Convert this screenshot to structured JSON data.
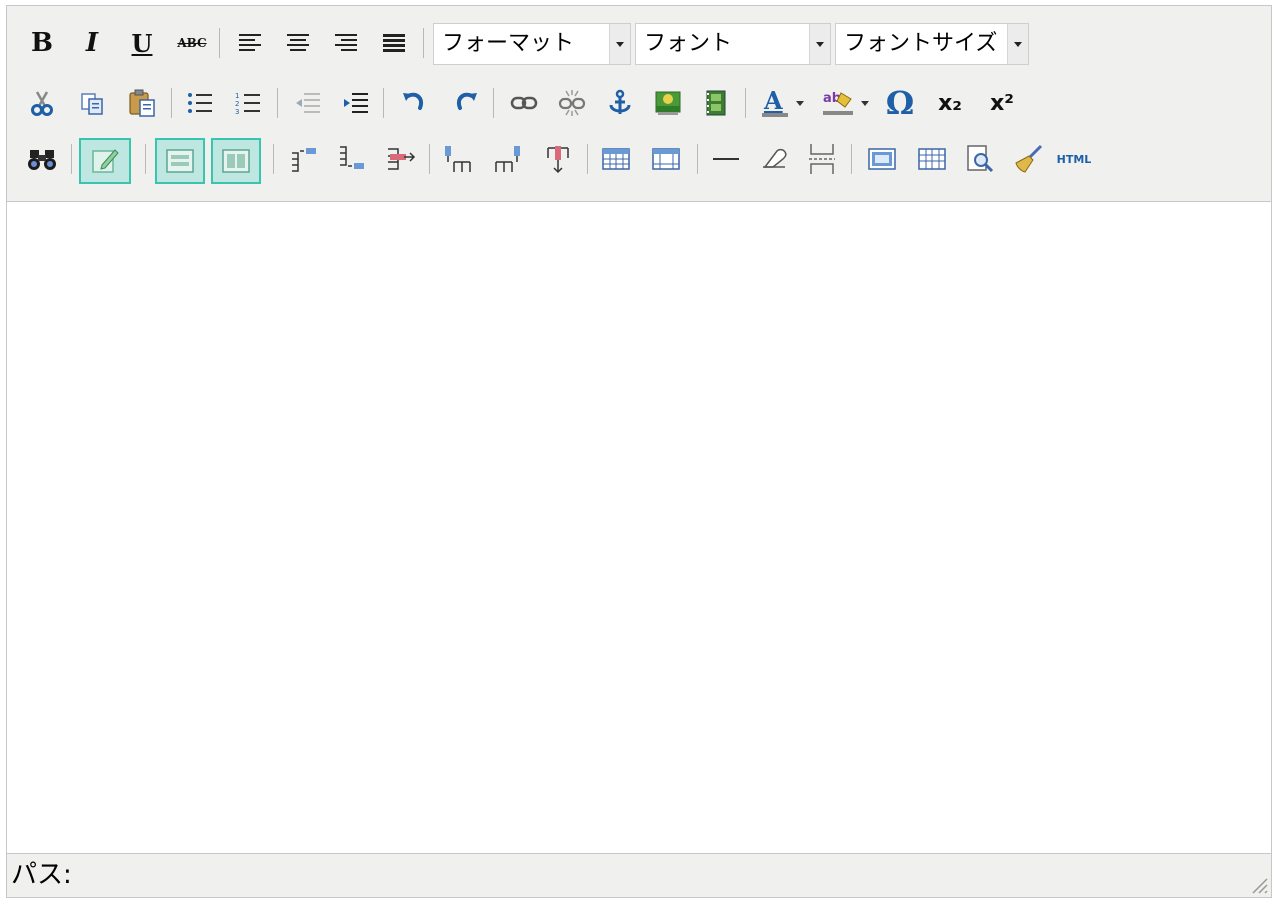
{
  "editor": {
    "selects": {
      "format": "フォーマット",
      "font": "フォント",
      "font_size": "フォントサイズ"
    },
    "buttons": {
      "bold": "B",
      "italic": "I",
      "underline": "U",
      "strikethrough": "ABC",
      "subscript": "x₂",
      "superscript": "x²",
      "special_char": "Ω",
      "html": "HTML"
    },
    "status": {
      "path_label": "パス:"
    },
    "colors": {
      "toolbar_bg": "#f0f0ee",
      "active_bg": "#bfe7e2",
      "active_border": "#39c4b0",
      "icon_blue": "#1f5fa8"
    },
    "icons": [
      "scissors-icon",
      "copy-icon",
      "paste-icon",
      "unordered-list-icon",
      "ordered-list-icon",
      "outdent-icon",
      "indent-icon",
      "undo-icon",
      "redo-icon",
      "link-icon",
      "unlink-icon",
      "anchor-icon",
      "image-icon",
      "media-icon",
      "text-color-icon",
      "highlight-color-icon",
      "find-icon",
      "visual-aid-icon",
      "table-icons"
    ]
  }
}
